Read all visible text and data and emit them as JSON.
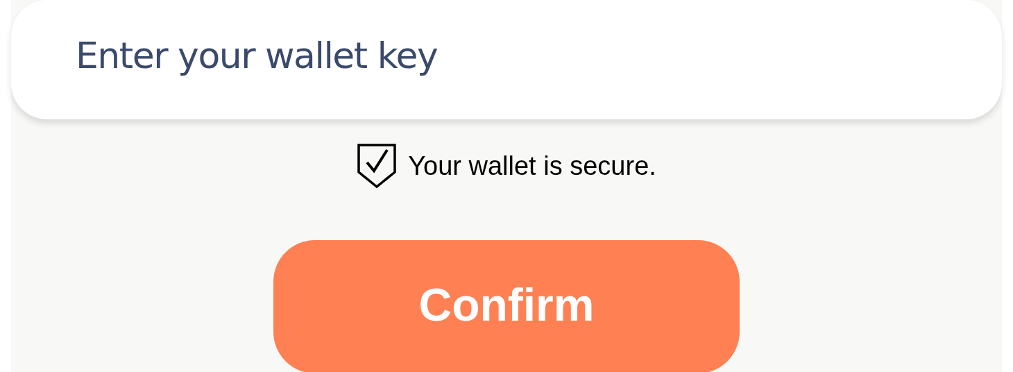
{
  "key_field": {
    "placeholder": "Enter your wallet key"
  },
  "security_note": {
    "text": "Your wallet is secure."
  },
  "buttons": [
    {
      "label": "Confirm",
      "kind": "primary"
    }
  ]
}
